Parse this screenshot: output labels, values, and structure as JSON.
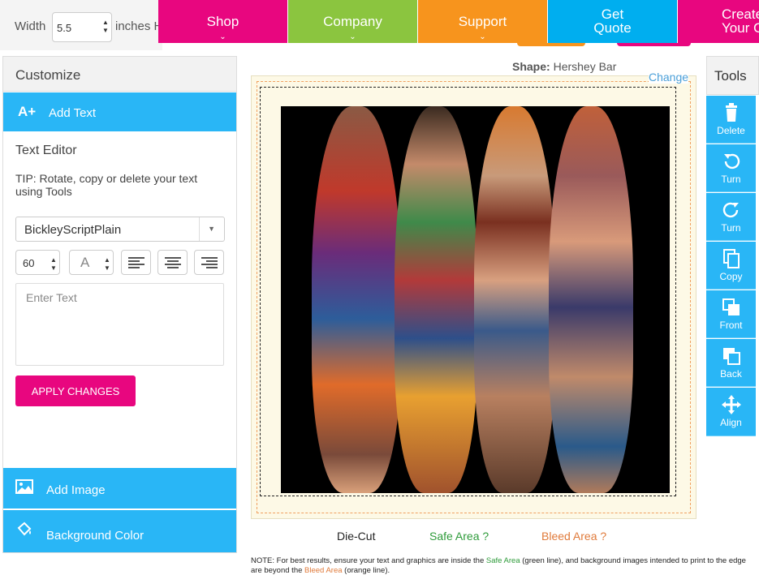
{
  "size": {
    "label": "Width",
    "value": "5.5",
    "unit": "inches H"
  },
  "nav": [
    {
      "label": "Shop",
      "color": "#e8067f"
    },
    {
      "label": "Company",
      "color": "#8bc53f"
    },
    {
      "label": "Support",
      "color": "#f7941d"
    },
    {
      "label_line1": "Get",
      "label_line2": "Quote",
      "color": "#00aeef"
    },
    {
      "label_line1": "Create",
      "label_line2": "Your Ow",
      "color": "#e8067f"
    }
  ],
  "sidebar": {
    "title": "Customize",
    "add_text": "Add Text",
    "editor_title": "Text Editor",
    "tip": "TIP: Rotate, copy or delete your text using Tools",
    "font": "BickleyScriptPlain",
    "font_size": "60",
    "color_letter": "A",
    "text_placeholder": "Enter Text",
    "apply": "APPLY CHANGES",
    "add_image": "Add Image",
    "background_color": "Background Color"
  },
  "canvas": {
    "shape_label": "Shape:",
    "shape_value": "Hershey Bar",
    "change": "Change",
    "die_cut": "Die-Cut",
    "safe_area": "Safe Area ?",
    "bleed_area": "Bleed Area ?",
    "note_prefix": "NOTE: For best results, ensure your text and graphics are inside the ",
    "note_safe": "Safe Area",
    "note_mid": " (green line), and background images intended to print to the edge are beyond the ",
    "note_bleed": "Bleed Area",
    "note_suffix": " (orange line)."
  },
  "tools": {
    "title": "Tools",
    "items": [
      {
        "label": "Delete",
        "icon": "trash-icon"
      },
      {
        "label": "Turn",
        "icon": "rotate-left-icon"
      },
      {
        "label": "Turn",
        "icon": "rotate-right-icon"
      },
      {
        "label": "Copy",
        "icon": "copy-icon"
      },
      {
        "label": "Front",
        "icon": "bring-front-icon"
      },
      {
        "label": "Back",
        "icon": "send-back-icon"
      },
      {
        "label": "Align",
        "icon": "move-arrows-icon"
      }
    ]
  },
  "colors": {
    "accent_blue": "#29b6f6",
    "pink": "#e8067f",
    "safe_green": "#2e9b3a",
    "bleed_orange": "#e07a3a"
  }
}
